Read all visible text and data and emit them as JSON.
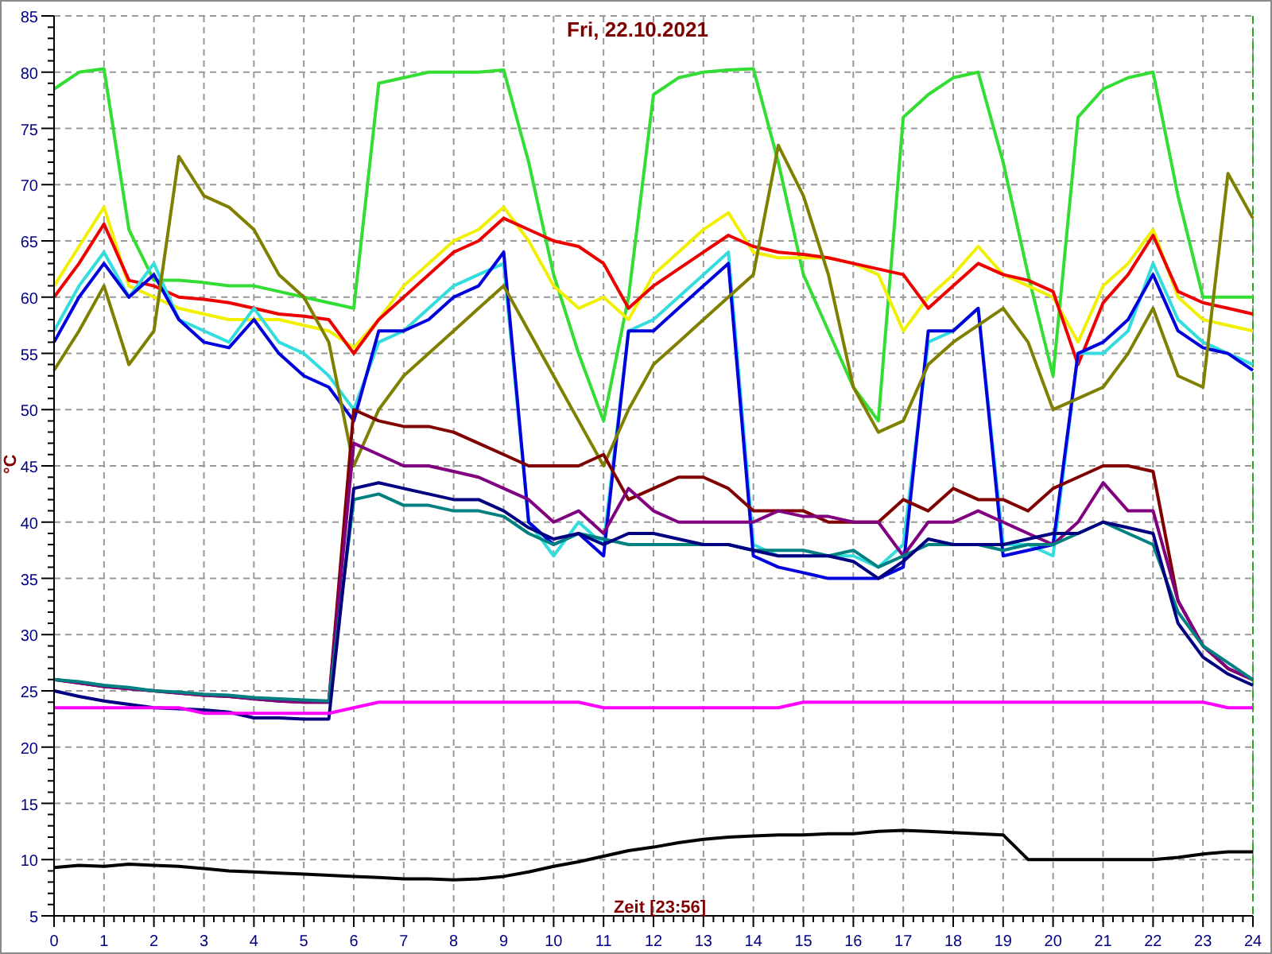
{
  "chart": {
    "chart_data": {
      "type": "line",
      "grid": true,
      "title": "Fri, 22.10.2021",
      "xlabel": "Zeit [23:56]",
      "ylabel": "°C",
      "x": [
        0,
        0.5,
        1,
        1.5,
        2,
        2.5,
        3,
        3.5,
        4,
        4.5,
        5,
        5.5,
        6,
        6.5,
        7,
        7.5,
        8,
        8.5,
        9,
        9.5,
        10,
        10.5,
        11,
        11.5,
        12,
        12.5,
        13,
        13.5,
        14,
        14.5,
        15,
        15.5,
        16,
        16.5,
        17,
        17.5,
        18,
        18.5,
        19,
        19.5,
        20,
        20.5,
        21,
        21.5,
        22,
        22.5,
        23,
        23.5,
        24
      ],
      "xlim": [
        0,
        24
      ],
      "ylim": [
        5,
        85
      ],
      "xticks": [
        0,
        1,
        2,
        3,
        4,
        5,
        6,
        7,
        8,
        9,
        10,
        11,
        12,
        13,
        14,
        15,
        16,
        17,
        18,
        19,
        20,
        21,
        22,
        23,
        24
      ],
      "yticks": [
        5,
        10,
        15,
        20,
        25,
        30,
        35,
        40,
        45,
        50,
        55,
        60,
        65,
        70,
        75,
        80,
        85
      ],
      "series": [
        {
          "color": "#33dd33",
          "values": [
            78.5,
            80,
            80.3,
            66,
            61.5,
            61.5,
            61.3,
            61,
            61,
            60.5,
            60,
            59.5,
            59,
            79,
            79.5,
            80,
            80,
            80,
            80.2,
            72,
            62,
            55,
            49,
            60,
            78,
            79.5,
            80,
            80.2,
            80.3,
            72,
            62,
            57,
            52,
            49,
            76,
            78,
            79.5,
            80,
            72,
            62,
            53,
            76,
            78.5,
            79.5,
            80,
            69,
            60,
            60,
            60
          ]
        },
        {
          "color": "#f0f000",
          "values": [
            61,
            64.5,
            68,
            61,
            60,
            59,
            58.5,
            58,
            58,
            58,
            57.5,
            57,
            55.5,
            58,
            61,
            63,
            65,
            66,
            68,
            65,
            61,
            59,
            60,
            58,
            62,
            64,
            66,
            67.5,
            64,
            63.5,
            63.5,
            63.5,
            63,
            62,
            57,
            60,
            62,
            64.5,
            62,
            61,
            60,
            56,
            61,
            63,
            66,
            60,
            58,
            57.5,
            57
          ]
        },
        {
          "color": "#ee0000",
          "values": [
            60,
            63,
            66.5,
            61.5,
            61,
            60,
            59.8,
            59.5,
            59,
            58.5,
            58.3,
            58,
            55,
            58,
            60,
            62,
            64,
            65,
            67,
            66,
            65,
            64.5,
            63,
            59,
            61,
            62.5,
            64,
            65.5,
            64.5,
            64,
            63.8,
            63.5,
            63,
            62.5,
            62,
            59,
            61,
            63,
            62,
            61.5,
            60.5,
            54,
            59.5,
            62,
            65.5,
            60.5,
            59.5,
            59,
            58.5
          ]
        },
        {
          "color": "#33dddd",
          "values": [
            57,
            61,
            64,
            60,
            63,
            58,
            57,
            56,
            59,
            56,
            55,
            53,
            50,
            56,
            57,
            59,
            61,
            62,
            63,
            40,
            37,
            40,
            38,
            57,
            58,
            60,
            62,
            64,
            38,
            37,
            37,
            37,
            37,
            36,
            38,
            56,
            57,
            59,
            38,
            38,
            37,
            55,
            55,
            57,
            63,
            58,
            56,
            55,
            54
          ]
        },
        {
          "color": "#0000dd",
          "values": [
            56,
            60,
            63,
            60,
            62,
            58,
            56,
            55.5,
            58,
            55,
            53,
            52,
            49,
            57,
            57,
            58,
            60,
            61,
            64,
            40,
            38,
            39,
            37,
            57,
            57,
            59,
            61,
            63,
            37,
            36,
            35.5,
            35,
            35,
            35,
            36,
            57,
            57,
            59,
            37,
            37.5,
            38,
            55,
            56,
            58,
            62,
            57,
            55.5,
            55,
            53.5
          ]
        },
        {
          "color": "#808000",
          "values": [
            53.5,
            57,
            61,
            54,
            57,
            72.5,
            69,
            68,
            66,
            62,
            60,
            56,
            45,
            50,
            53,
            55,
            57,
            59,
            61,
            57,
            53,
            49,
            45,
            50,
            54,
            56,
            58,
            60,
            62,
            73.5,
            69,
            62,
            52,
            48,
            49,
            54,
            56,
            57.5,
            59,
            56,
            50,
            51,
            52,
            55,
            59,
            53,
            52,
            71,
            67
          ]
        },
        {
          "color": "#800000",
          "values": [
            26,
            25.7,
            25.4,
            25.2,
            25,
            24.8,
            24.6,
            24.5,
            24.3,
            24.1,
            24,
            24,
            50,
            49,
            48.5,
            48.5,
            48,
            47,
            46,
            45,
            45,
            45,
            46,
            42,
            43,
            44,
            44,
            43,
            41,
            41,
            41,
            40,
            40,
            40,
            42,
            41,
            43,
            42,
            42,
            41,
            43,
            44,
            45,
            45,
            44.5,
            33,
            29,
            27,
            26
          ]
        },
        {
          "color": "#800080",
          "values": [
            26,
            25.7,
            25.4,
            25.2,
            25,
            24.8,
            24.6,
            24.5,
            24.3,
            24.1,
            24,
            24,
            47,
            46,
            45,
            45,
            44.5,
            44,
            43,
            42,
            40,
            41,
            39,
            43,
            41,
            40,
            40,
            40,
            40,
            41,
            40.5,
            40.5,
            40,
            40,
            37,
            40,
            40,
            41,
            40,
            39,
            38,
            40,
            43.5,
            41,
            41,
            33,
            29,
            27,
            26
          ]
        },
        {
          "color": "#008080",
          "values": [
            26,
            25.8,
            25.5,
            25.3,
            25,
            24.9,
            24.7,
            24.6,
            24.4,
            24.3,
            24.2,
            24.1,
            42,
            42.5,
            41.5,
            41.5,
            41,
            41,
            40.5,
            39,
            38,
            39,
            38.5,
            38,
            38,
            38,
            38,
            38,
            37.5,
            37.5,
            37.5,
            37,
            37.5,
            36,
            37,
            38,
            38,
            38,
            37.5,
            38,
            38,
            39,
            40,
            39,
            38,
            32,
            29,
            27.5,
            26
          ]
        },
        {
          "color": "#000080",
          "values": [
            25,
            24.5,
            24.1,
            23.8,
            23.5,
            23.4,
            23.3,
            23.1,
            22.6,
            22.6,
            22.5,
            22.5,
            43,
            43.5,
            43,
            42.5,
            42,
            42,
            41,
            39.5,
            38.5,
            39,
            38,
            39,
            39,
            38.5,
            38,
            38,
            37.5,
            37,
            37,
            37,
            36.5,
            35,
            36.5,
            38.5,
            38,
            38,
            38,
            38.5,
            39,
            39,
            40,
            39.5,
            39,
            31,
            28,
            26.5,
            25.5
          ]
        },
        {
          "color": "#ff00ff",
          "values": [
            23.5,
            23.5,
            23.5,
            23.5,
            23.5,
            23.5,
            23,
            23,
            23,
            23,
            23,
            23,
            23.5,
            24,
            24,
            24,
            24,
            24,
            24,
            24,
            24,
            24,
            23.5,
            23.5,
            23.5,
            23.5,
            23.5,
            23.5,
            23.5,
            23.5,
            24,
            24,
            24,
            24,
            24,
            24,
            24,
            24,
            24,
            24,
            24,
            24,
            24,
            24,
            24,
            24,
            24,
            23.5,
            23.5
          ]
        },
        {
          "color": "#000000",
          "values": [
            9.3,
            9.5,
            9.4,
            9.6,
            9.5,
            9.4,
            9.2,
            9,
            8.9,
            8.8,
            8.7,
            8.6,
            8.5,
            8.4,
            8.3,
            8.3,
            8.2,
            8.3,
            8.5,
            8.9,
            9.4,
            9.8,
            10.3,
            10.8,
            11.1,
            11.5,
            11.8,
            12,
            12.1,
            12.2,
            12.2,
            12.3,
            12.3,
            12.5,
            12.6,
            12.5,
            12.4,
            12.3,
            12.2,
            10,
            10,
            10,
            10,
            10,
            10,
            10.2,
            10.5,
            10.7,
            10.7
          ]
        }
      ]
    }
  }
}
